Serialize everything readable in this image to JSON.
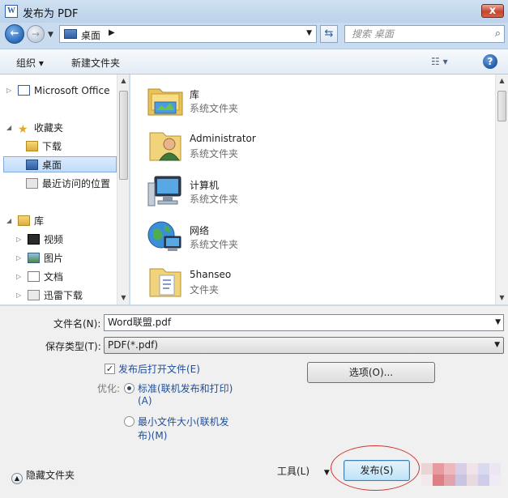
{
  "window": {
    "title": "发布为 PDF",
    "app_icon": "W",
    "close_label": "x"
  },
  "address": {
    "location": "桌面",
    "search_placeholder": "搜索 桌面"
  },
  "toolbar": {
    "organize": "组织 ▾",
    "new_folder": "新建文件夹"
  },
  "nav_pane": {
    "items": [
      {
        "label": "Microsoft Office ",
        "icon": "word-icon"
      },
      {
        "label": "收藏夹",
        "icon": "star-icon"
      },
      {
        "label": "下载",
        "icon": "download-folder-icon"
      },
      {
        "label": "桌面",
        "icon": "desktop-icon",
        "selected": true
      },
      {
        "label": "最近访问的位置",
        "icon": "recent-places-icon"
      },
      {
        "label": "库",
        "icon": "library-icon"
      },
      {
        "label": "视频",
        "icon": "video-icon"
      },
      {
        "label": "图片",
        "icon": "pictures-icon"
      },
      {
        "label": "文档",
        "icon": "documents-icon"
      },
      {
        "label": "迅雷下载",
        "icon": "thunder-download-icon"
      }
    ]
  },
  "file_list": {
    "items": [
      {
        "name": "库",
        "type": "系统文件夹",
        "icon": "library-folder-icon"
      },
      {
        "name": "Administrator",
        "type": "系统文件夹",
        "icon": "user-folder-icon"
      },
      {
        "name": "计算机",
        "type": "系统文件夹",
        "icon": "computer-icon"
      },
      {
        "name": "网络",
        "type": "系统文件夹",
        "icon": "network-globe-icon"
      },
      {
        "name": "5hanseo",
        "type": "文件夹",
        "icon": "folder-icon"
      }
    ]
  },
  "form": {
    "filename_label": "文件名(N):",
    "filename_value": "Word联盟.pdf",
    "filetype_label": "保存类型(T):",
    "filetype_value": "PDF(*.pdf)",
    "open_after_publish": "发布后打开文件(E)",
    "optimize_label": "优化:",
    "opt_standard_line1": "标准(联机发布和打印)",
    "opt_standard_line2": "(A)",
    "opt_min_line1": "最小文件大小(联机发",
    "opt_min_line2": "布)(M)",
    "options_button": "选项(O)...",
    "hide_folders": "隐藏文件夹",
    "tools_label": "工具(L)",
    "publish_button": "发布(S)"
  },
  "colors": {
    "accent": "#1f4e9c",
    "highlight_ring": "#d23232"
  }
}
